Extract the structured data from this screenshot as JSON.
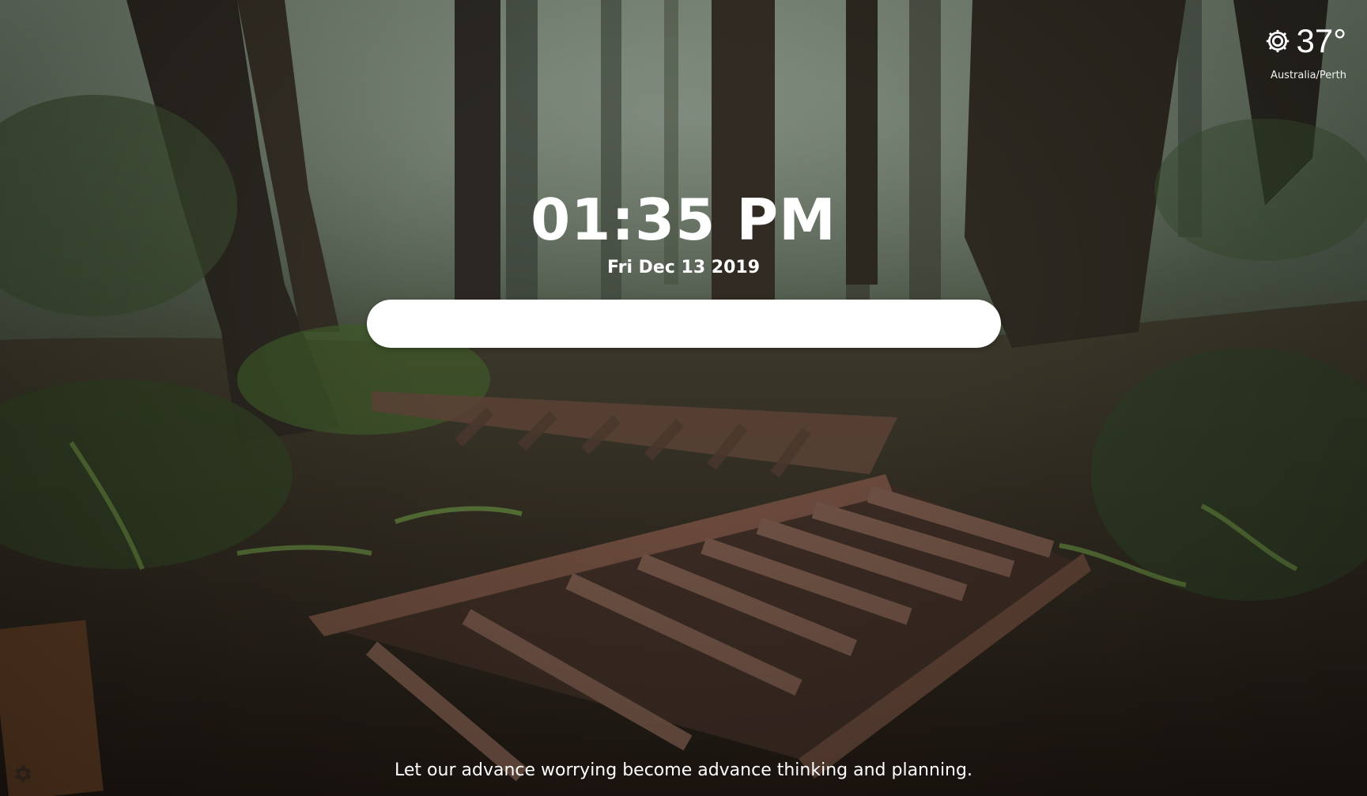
{
  "weather": {
    "icon": "gear-sun-icon",
    "temperature": "37°",
    "location": "Australia/Perth"
  },
  "clock": {
    "time": "01:35 PM",
    "date": "Fri Dec 13 2019"
  },
  "search": {
    "value": "",
    "placeholder": ""
  },
  "quote": {
    "text": "Let our advance worrying become advance thinking and planning."
  },
  "settings": {
    "icon": "gear-icon"
  },
  "colors": {
    "text": "#ffffff",
    "search_background": "#ffffff"
  }
}
